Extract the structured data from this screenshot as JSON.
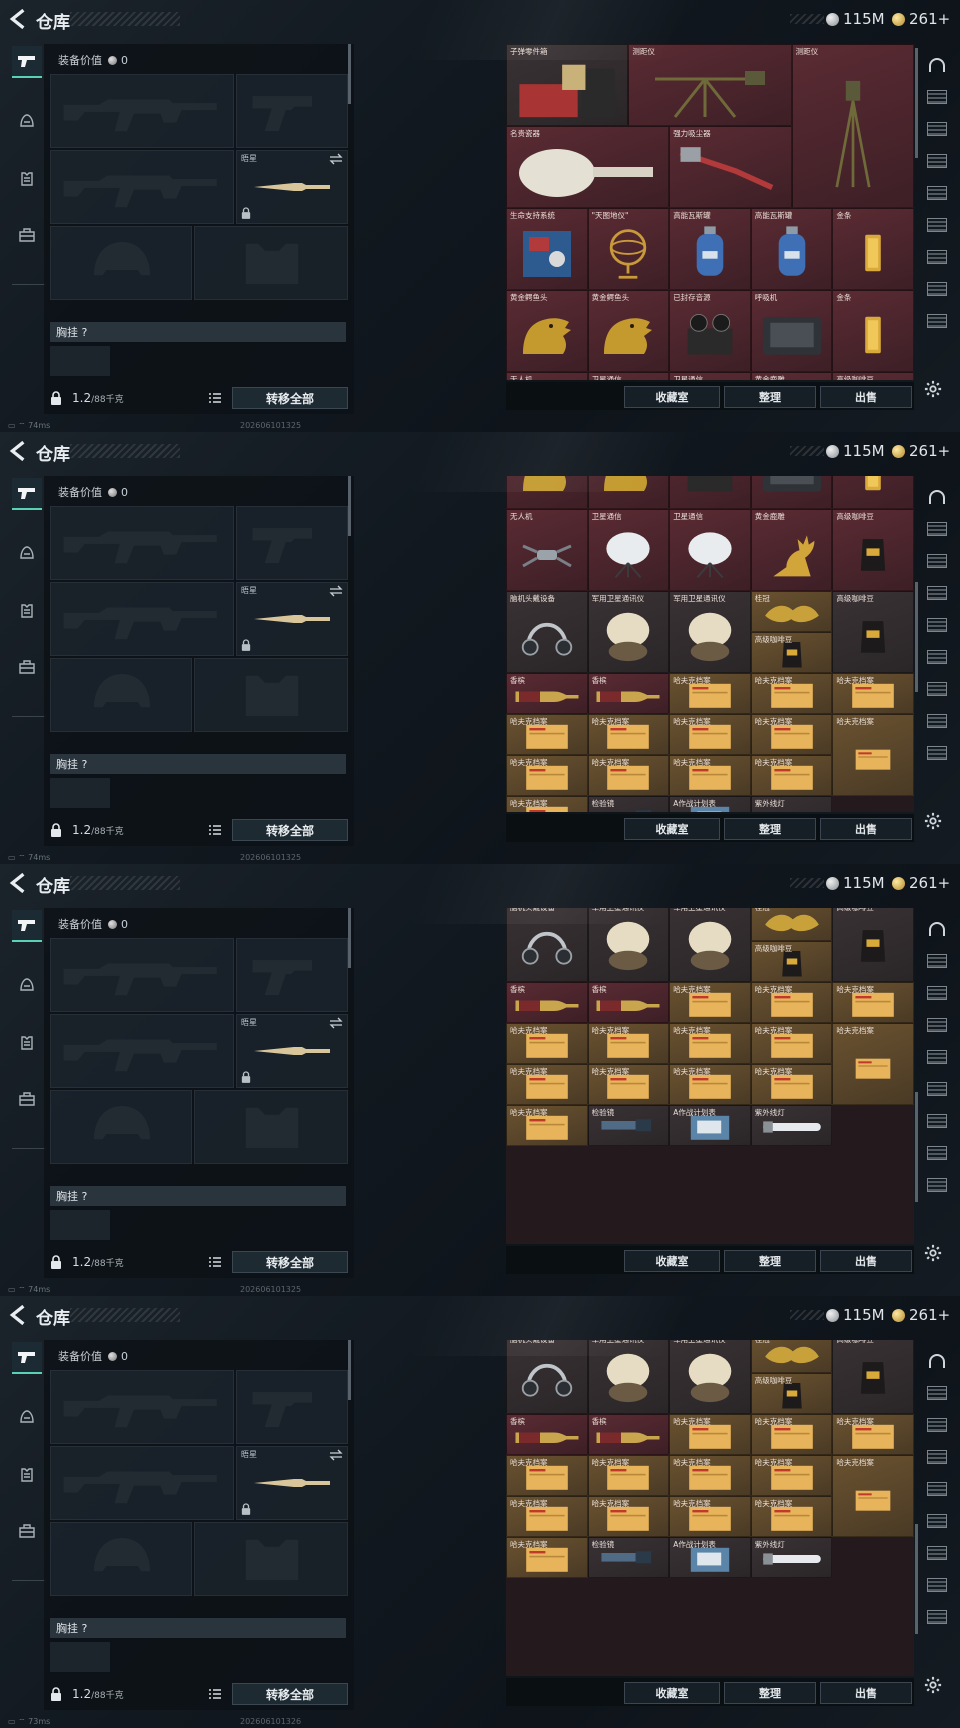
{
  "app": {
    "title": "仓库",
    "currency_silver": "115M",
    "currency_gold": "261+",
    "ping": "74ms",
    "ping_last": "73ms"
  },
  "frames": [
    {
      "timestamp": "202606101325",
      "ping": "74ms"
    },
    {
      "timestamp": "202606101325",
      "ping": "74ms"
    },
    {
      "timestamp": "202606101325",
      "ping": "74ms"
    },
    {
      "timestamp": "202606101326",
      "ping": "73ms"
    }
  ],
  "equip": {
    "value_label": "装备价值",
    "value": "0",
    "secondary_weapon_name": "晤星",
    "chest_rig_label": "胸挂 ?",
    "weight": "1.2",
    "weight_unit": "/88千克",
    "transfer_all": "转移全部"
  },
  "stash_buttons": {
    "collection": "收藏室",
    "organize": "整理",
    "sell": "出售"
  },
  "items": {
    "bullet_parts": "子弹零件箱",
    "rangefinder": "测距仪",
    "theodolite": "测距仪",
    "porcelain": "名贵瓷器",
    "vacuum": "强力吸尘器",
    "life_system": "生命支持系统",
    "armillary": "\"天图地仪\"",
    "gas_tank": "高能瓦斯罐",
    "gold_bar": "金条",
    "gold_croc": "黄金鳄鱼头",
    "recorder": "已封存音源",
    "respirator": "呼吸机",
    "drone": "无人机",
    "satcom": "卫星通信",
    "gold_deer": "黄金鹿雕",
    "coffee": "高级咖啡豆",
    "headset": "脑机头戴设备",
    "military_sat": "军用卫星通讯仪",
    "crown": "桂冠",
    "champagne": "香槟",
    "havak": "哈夫克档案",
    "inspector": "检验镜",
    "ops_plan": "A作战计划表",
    "uv_lamp": "紫外线灯"
  }
}
